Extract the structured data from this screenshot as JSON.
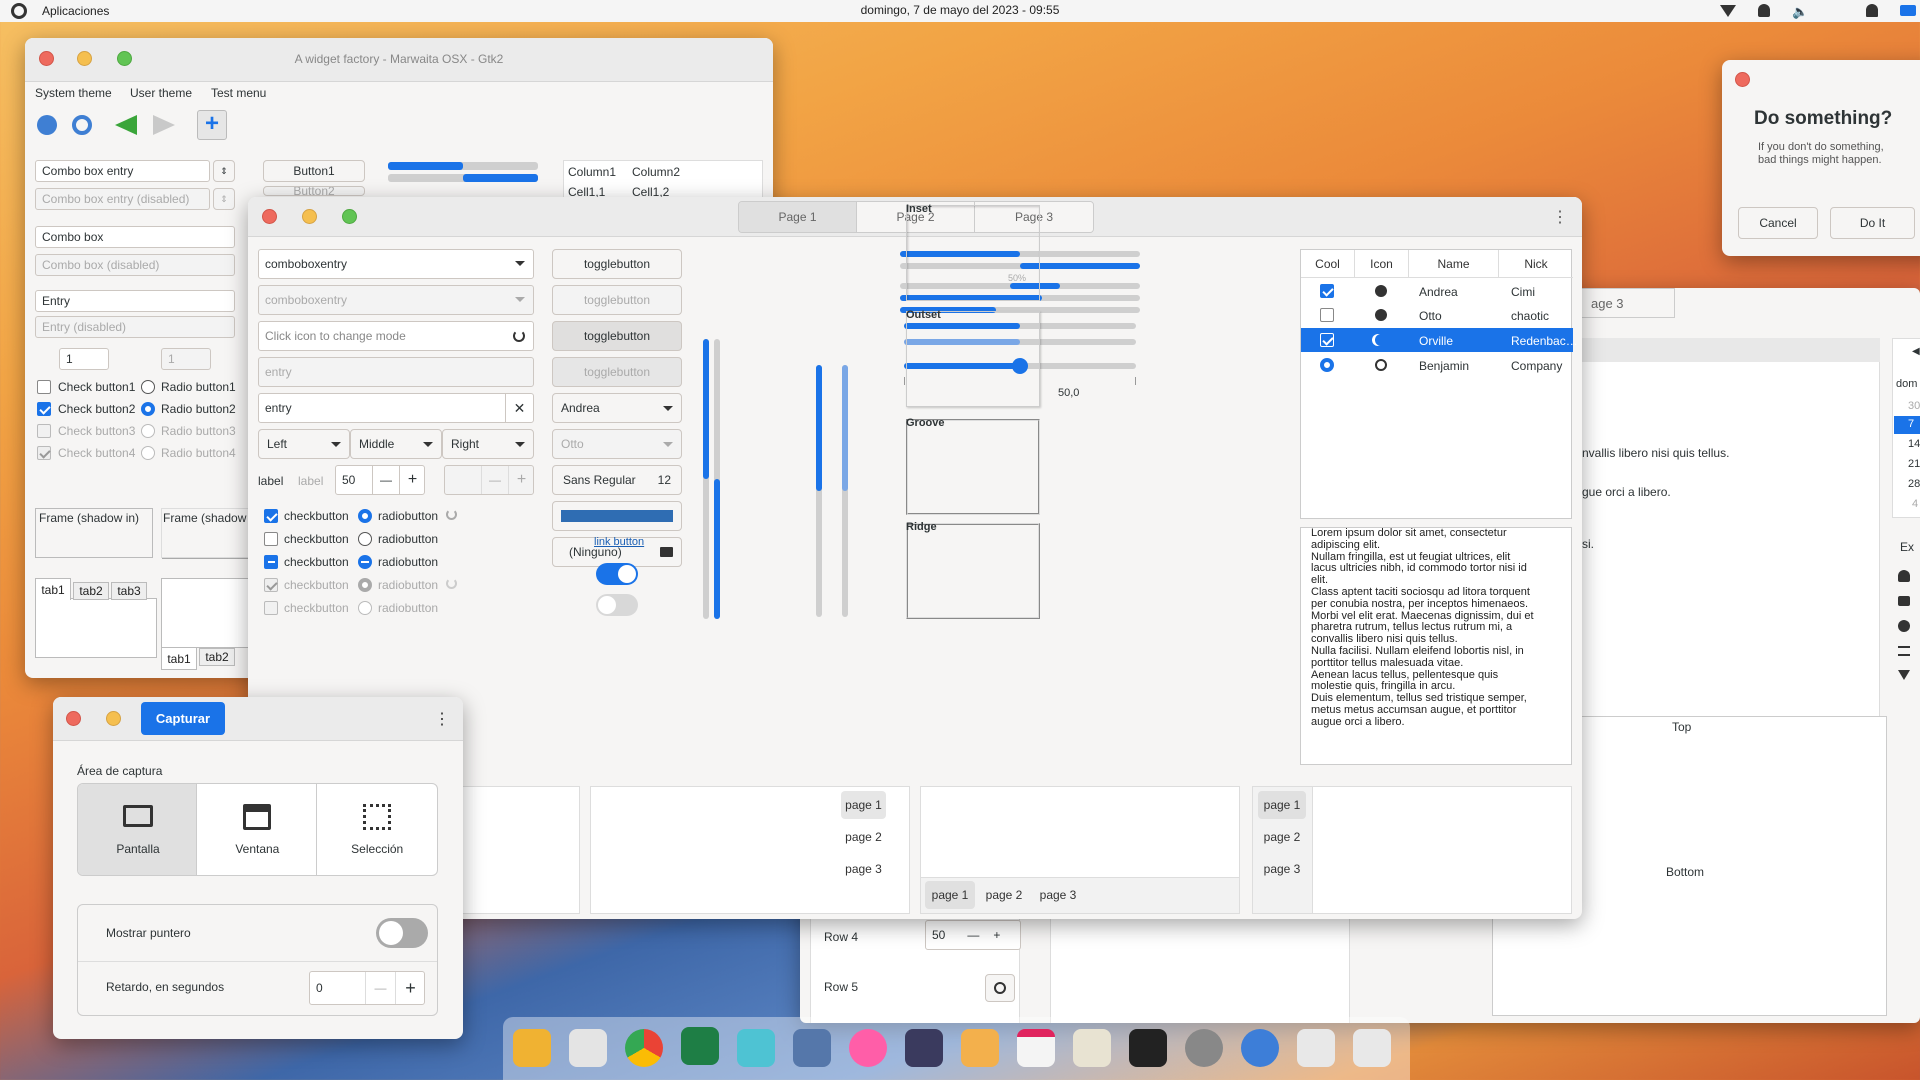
{
  "topbar": {
    "menu": "Aplicaciones",
    "clock": "domingo,  7 de mayo del 2023 - 09:55"
  },
  "factory": {
    "title": "A widget factory - Marwaita OSX - Gtk2",
    "menus": [
      "System theme",
      "User theme",
      "Test menu"
    ],
    "combo_entry": "Combo box entry",
    "combo_entry_dis": "Combo box entry (disabled)",
    "combo": "Combo box",
    "combo_dis": "Combo box (disabled)",
    "entry": "Entry",
    "entry_dis": "Entry (disabled)",
    "spin1": "1",
    "spin2": "1",
    "checks": [
      "Check button1",
      "Check button2",
      "Check button3",
      "Check button4"
    ],
    "radios": [
      "Radio button1",
      "Radio button2",
      "Radio button3",
      "Radio button4"
    ],
    "button1": "Button1",
    "button2": "Button2",
    "col1": "Column1",
    "col2": "Column2",
    "cell1": "Cell1,1",
    "cell2": "Cell1,2",
    "frame_in": "Frame (shadow in)",
    "frame_out": "Frame (shadow",
    "tabs": [
      "tab1",
      "tab2",
      "tab3"
    ],
    "tabs2": [
      "tab1",
      "tab2"
    ]
  },
  "main": {
    "pages": [
      "Page 1",
      "Page 2",
      "Page 3"
    ],
    "comboboxentry": "comboboxentry",
    "comboboxentry_dis": "comboboxentry",
    "icon_entry_ph": "Click icon to change mode",
    "entry_ph": "entry",
    "entry_val": "entry",
    "seg": [
      "Left",
      "Middle",
      "Right"
    ],
    "label": "label",
    "label_dis": "label",
    "spin": "50",
    "checks": [
      "checkbutton",
      "checkbutton",
      "checkbutton",
      "checkbutton",
      "checkbutton"
    ],
    "radios": [
      "radiobutton",
      "radiobutton",
      "radiobutton",
      "radiobutton",
      "radiobutton"
    ],
    "toggles": [
      "togglebutton",
      "togglebutton",
      "togglebutton",
      "togglebutton"
    ],
    "combo_andrea": "Andrea",
    "combo_otto": "Otto",
    "font": "Sans Regular",
    "font_size": "12",
    "file": "(Ninguno)",
    "link": "link button",
    "switch_on": true,
    "switch_off": false,
    "progress_label": "50%",
    "scale_value": "50,0",
    "scale_fraction": 0.5,
    "frames": [
      "Inset",
      "Outset",
      "Groove",
      "Ridge"
    ],
    "tree_headers": [
      "Cool",
      "Icon",
      "Name",
      "Nick"
    ],
    "tree_rows": [
      {
        "name": "Andrea",
        "nick": "Cimi"
      },
      {
        "name": "Otto",
        "nick": "chaotic"
      },
      {
        "name": "Orville",
        "nick": "Redenbac…"
      },
      {
        "name": "Benjamin",
        "nick": "Company"
      }
    ],
    "text_lines": [
      "Lorem ipsum dolor sit amet, consectetur",
      "adipiscing elit.",
      "Nullam fringilla, est ut feugiat ultrices, elit",
      "lacus ultricies nibh, id commodo tortor nisi id",
      "elit.",
      "Class aptent taciti sociosqu ad litora torquent",
      "per conubia nostra, per inceptos himenaeos.",
      "Morbi vel elit erat. Maecenas dignissim, dui et",
      "pharetra rutrum, tellus lectus rutrum mi, a",
      "convallis libero nisi quis tellus.",
      "Nulla facilisi. Nullam eleifend lobortis nisl, in",
      "porttitor tellus malesuada vitae.",
      "Aenean lacus tellus, pellentesque quis",
      "molestie quis, fringilla in arcu.",
      "Duis elementum, tellus sed tristique semper,",
      "metus metus accumsan augue, et porttitor",
      "augue orci a libero."
    ],
    "nb_pages": [
      "page 1",
      "page 2",
      "page 3"
    ]
  },
  "dialog": {
    "title": "Do something?",
    "body": "If you don't do something,\nbad things might happen.",
    "cancel": "Cancel",
    "ok": "Do It"
  },
  "capture": {
    "capture_btn": "Capturar",
    "area_label": "Área de captura",
    "modes": [
      "Pantalla",
      "Ventana",
      "Selección"
    ],
    "pointer": "Mostrar puntero",
    "delay": "Retardo, en segundos",
    "delay_val": "0"
  },
  "bg": {
    "tab": "age 3",
    "text1": "nvallis libero nisi quis tellus.",
    "text2": "gue orci a libero.",
    "text3": "si.",
    "cal_hdr": "dom",
    "cal": [
      "30",
      "7",
      "14",
      "21",
      "28",
      "4"
    ],
    "exp": "Ex",
    "top": "Top",
    "bottom": "Bottom",
    "row4": "Row 4",
    "row4_val": "50",
    "row5": "Row 5"
  }
}
